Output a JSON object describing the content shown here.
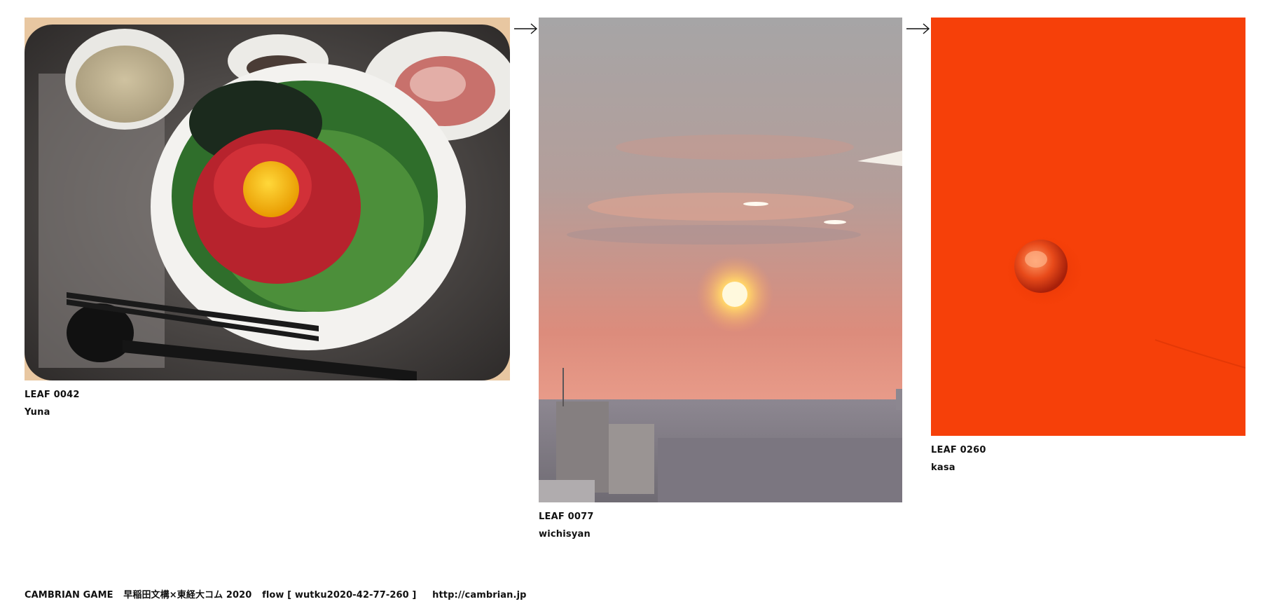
{
  "leaves": [
    {
      "id_label": "LEAF 0042",
      "author": "Yuna",
      "image_subject": "yukhoe rice bowl with egg yolk, soup and kimchi on tray"
    },
    {
      "id_label": "LEAF 0077",
      "author": "wichisyan",
      "image_subject": "hazy orange sunset over city skyline"
    },
    {
      "id_label": "LEAF 0260",
      "author": "kasa",
      "image_subject": "small red-orange bead on vivid orange surface"
    }
  ],
  "arrows": [
    "arrow-right-icon",
    "arrow-right-icon"
  ],
  "footer": {
    "project": "CAMBRIAN GAME",
    "collab": "早稲田文構×東経大コム 2020",
    "flow": "flow [ wutku2020-42-77-260 ]",
    "link": "http://cambrian.jp"
  },
  "colors": {
    "background": "#ffffff",
    "text": "#111111",
    "orange": "#f53c06",
    "sunset_sky_top": "#a6a5a6",
    "sunset_sky_bottom": "#e9907a"
  }
}
